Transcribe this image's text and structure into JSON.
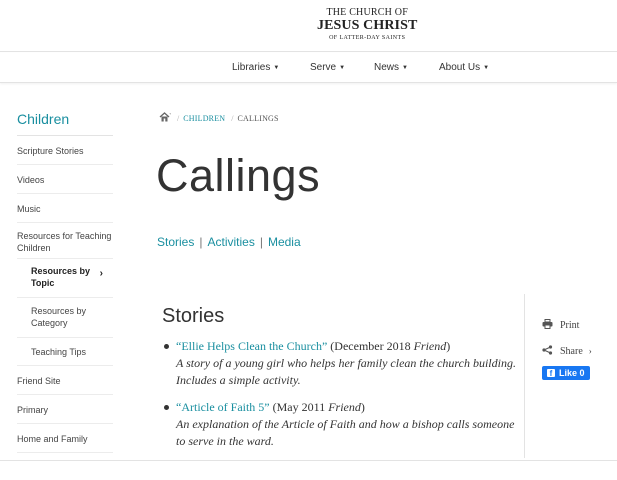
{
  "logo": {
    "line1": "THE CHURCH OF",
    "line2": "JESUS CHRIST",
    "line3": "OF LATTER-DAY SAINTS"
  },
  "nav": {
    "items": [
      {
        "label": "Libraries"
      },
      {
        "label": "Serve"
      },
      {
        "label": "News"
      },
      {
        "label": "About Us"
      }
    ]
  },
  "sidebar": {
    "title": "Children",
    "items": [
      {
        "label": "Scripture Stories"
      },
      {
        "label": "Videos"
      },
      {
        "label": "Music"
      },
      {
        "label": "Resources for Teaching Children"
      },
      {
        "label": "Resources by Topic"
      },
      {
        "label": "Resources by Category"
      },
      {
        "label": "Teaching Tips"
      },
      {
        "label": "Friend Site"
      },
      {
        "label": "Primary"
      },
      {
        "label": "Home and Family"
      }
    ]
  },
  "breadcrumb": {
    "link": "CHILDREN",
    "current": "CALLINGS"
  },
  "page": {
    "title": "Callings"
  },
  "tabs": [
    {
      "label": "Stories"
    },
    {
      "label": "Activities"
    },
    {
      "label": "Media"
    }
  ],
  "stories": {
    "heading": "Stories",
    "items": [
      {
        "title": "“Ellie Helps Clean the Church”",
        "source_pre": " (December 2018 ",
        "source_mag": "Friend",
        "source_post": ")",
        "desc": "A story of a young girl who helps her family clean the church building. Includes a simple activity."
      },
      {
        "title": "“Article of Faith 5”",
        "source_pre": " (May 2011 ",
        "source_mag": "Friend",
        "source_post": ")",
        "desc": "An explanation of the Article of Faith and how a bishop calls someone to serve in the ward."
      }
    ]
  },
  "rail": {
    "print": "Print",
    "share": "Share",
    "like": "Like 0"
  },
  "colors": {
    "accent": "#1a8fa0",
    "facebook": "#1877f2"
  }
}
